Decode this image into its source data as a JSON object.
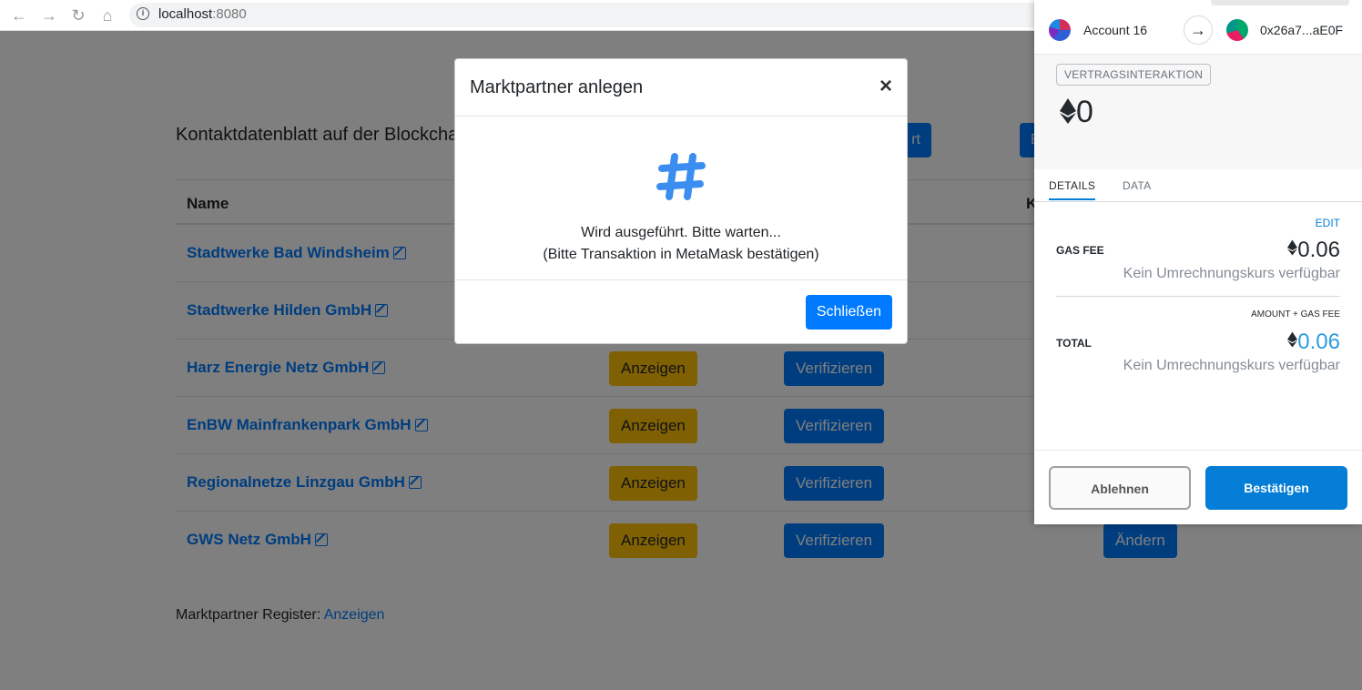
{
  "browser": {
    "url_host": "localhost",
    "url_port": ":8080"
  },
  "page": {
    "title": "Kontaktdatenblatt auf der Blockchain",
    "top_buttons": [
      "rt",
      "B"
    ],
    "columns": {
      "name": "Name",
      "k": "K"
    },
    "rows": [
      {
        "name": "Stadtwerke Bad Windsheim"
      },
      {
        "name": "Stadtwerke Hilden GmbH"
      },
      {
        "name": "Harz Energie Netz GmbH",
        "show": "Anzeigen",
        "verify": "Verifizieren"
      },
      {
        "name": "EnBW Mainfrankenpark GmbH",
        "show": "Anzeigen",
        "verify": "Verifizieren"
      },
      {
        "name": "Regionalnetze Linzgau GmbH",
        "show": "Anzeigen",
        "verify": "Verifizieren"
      },
      {
        "name": "GWS Netz GmbH",
        "show": "Anzeigen",
        "verify": "Verifizieren",
        "change": "Ändern"
      }
    ],
    "footer_label": "Marktpartner Register:",
    "footer_link": "Anzeigen"
  },
  "modal": {
    "title": "Marktpartner anlegen",
    "close": "×",
    "line1": "Wird ausgeführt. Bitte warten...",
    "line2": "(Bitte Transaktion in MetaMask bestätigen)",
    "button": "Schließen"
  },
  "metamask": {
    "from_account": "Account 16",
    "to_address": "0x26a7...aE0F",
    "badge": "VERTRAGSINTERAKTION",
    "amount": "0",
    "tabs": [
      "DETAILS",
      "DATA"
    ],
    "edit": "EDIT",
    "gas_fee_label": "GAS FEE",
    "gas_fee_value": "0.06",
    "no_rate": "Kein Umrechnungskurs verfügbar",
    "total_hint": "AMOUNT + GAS FEE",
    "total_label": "TOTAL",
    "total_value": "0.06",
    "reject": "Ablehnen",
    "confirm": "Bestätigen",
    "colors": {
      "accent": "#037dd6",
      "total": "#2f9ae0"
    }
  },
  "icons": [
    "back-arrow-icon",
    "forward-arrow-icon",
    "reload-icon",
    "home-icon",
    "info-icon",
    "edit-icon",
    "hash-icon",
    "ethereum-icon",
    "arrow-right-icon"
  ]
}
